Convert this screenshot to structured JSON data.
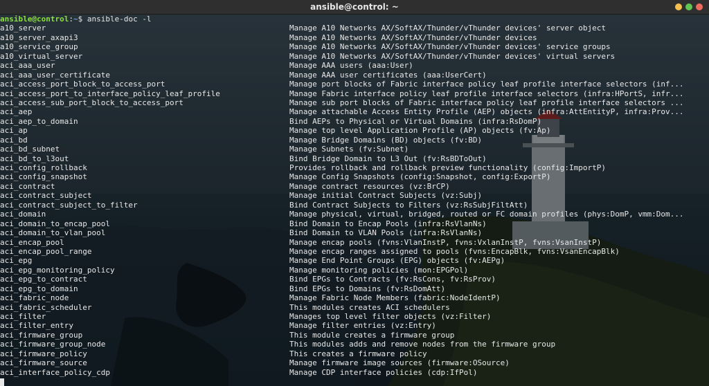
{
  "window": {
    "title": "ansible@control: ~",
    "buttons": [
      {
        "name": "minimize",
        "color": "#f4bf4f"
      },
      {
        "name": "maximize",
        "color": "#61c554"
      },
      {
        "name": "close",
        "color": "#ed6a5e"
      }
    ]
  },
  "terminal": {
    "prompt_user": "ansible@control",
    "prompt_sep": ":",
    "prompt_path": "~",
    "prompt_symbol": "$ ",
    "command": "ansible-doc -l",
    "colors": {
      "user": "#8ae234",
      "path": "#729fcf",
      "text": "#e8e8e8"
    },
    "rows": [
      {
        "module": "a10_server",
        "desc": "Manage A10 Networks AX/SoftAX/Thunder/vThunder devices' server object"
      },
      {
        "module": "a10_server_axapi3",
        "desc": "Manage A10 Networks AX/SoftAX/Thunder/vThunder devices"
      },
      {
        "module": "a10_service_group",
        "desc": "Manage A10 Networks AX/SoftAX/Thunder/vThunder devices' service groups"
      },
      {
        "module": "a10_virtual_server",
        "desc": "Manage A10 Networks AX/SoftAX/Thunder/vThunder devices' virtual servers"
      },
      {
        "module": "aci_aaa_user",
        "desc": "Manage AAA users (aaa:User)"
      },
      {
        "module": "aci_aaa_user_certificate",
        "desc": "Manage AAA user certificates (aaa:UserCert)"
      },
      {
        "module": "aci_access_port_block_to_access_port",
        "desc": "Manage port blocks of Fabric interface policy leaf profile interface selectors (inf..."
      },
      {
        "module": "aci_access_port_to_interface_policy_leaf_profile",
        "desc": "Manage Fabric interface policy leaf profile interface selectors (infra:HPortS, infr..."
      },
      {
        "module": "aci_access_sub_port_block_to_access_port",
        "desc": "Manage sub port blocks of Fabric interface policy leaf profile interface selectors ..."
      },
      {
        "module": "aci_aep",
        "desc": "Manage attachable Access Entity Profile (AEP) objects (infra:AttEntityP, infra:Prov..."
      },
      {
        "module": "aci_aep_to_domain",
        "desc": "Bind AEPs to Physical or Virtual Domains (infra:RsDomP)"
      },
      {
        "module": "aci_ap",
        "desc": "Manage top level Application Profile (AP) objects (fv:Ap)"
      },
      {
        "module": "aci_bd",
        "desc": "Manage Bridge Domains (BD) objects (fv:BD)"
      },
      {
        "module": "aci_bd_subnet",
        "desc": "Manage Subnets (fv:Subnet)"
      },
      {
        "module": "aci_bd_to_l3out",
        "desc": "Bind Bridge Domain to L3 Out (fv:RsBDToOut)"
      },
      {
        "module": "aci_config_rollback",
        "desc": "Provides rollback and rollback preview functionality (config:ImportP)"
      },
      {
        "module": "aci_config_snapshot",
        "desc": "Manage Config Snapshots (config:Snapshot, config:ExportP)"
      },
      {
        "module": "aci_contract",
        "desc": "Manage contract resources (vz:BrCP)"
      },
      {
        "module": "aci_contract_subject",
        "desc": "Manage initial Contract Subjects (vz:Subj)"
      },
      {
        "module": "aci_contract_subject_to_filter",
        "desc": "Bind Contract Subjects to Filters (vz:RsSubjFiltAtt)"
      },
      {
        "module": "aci_domain",
        "desc": "Manage physical, virtual, bridged, routed or FC domain profiles (phys:DomP, vmm:Dom..."
      },
      {
        "module": "aci_domain_to_encap_pool",
        "desc": "Bind Domain to Encap Pools (infra:RsVlanNs)"
      },
      {
        "module": "aci_domain_to_vlan_pool",
        "desc": "Bind Domain to VLAN Pools (infra:RsVlanNs)"
      },
      {
        "module": "aci_encap_pool",
        "desc": "Manage encap pools (fvns:VlanInstP, fvns:VxlanInstP, fvns:VsanInstP)"
      },
      {
        "module": "aci_encap_pool_range",
        "desc": "Manage encap ranges assigned to pools (fvns:EncapBlk, fvns:VsanEncapBlk)"
      },
      {
        "module": "aci_epg",
        "desc": "Manage End Point Groups (EPG) objects (fv:AEPg)"
      },
      {
        "module": "aci_epg_monitoring_policy",
        "desc": "Manage monitoring policies (mon:EPGPol)"
      },
      {
        "module": "aci_epg_to_contract",
        "desc": "Bind EPGs to Contracts (fv:RsCons, fv:RsProv)"
      },
      {
        "module": "aci_epg_to_domain",
        "desc": "Bind EPGs to Domains (fv:RsDomAtt)"
      },
      {
        "module": "aci_fabric_node",
        "desc": "Manage Fabric Node Members (fabric:NodeIdentP)"
      },
      {
        "module": "aci_fabric_scheduler",
        "desc": "This modules creates ACI schedulers"
      },
      {
        "module": "aci_filter",
        "desc": "Manages top level filter objects (vz:Filter)"
      },
      {
        "module": "aci_filter_entry",
        "desc": "Manage filter entries (vz:Entry)"
      },
      {
        "module": "aci_firmware_group",
        "desc": "This module creates a firmware group"
      },
      {
        "module": "aci_firmware_group_node",
        "desc": "This modules adds and remove nodes from the firmware group"
      },
      {
        "module": "aci_firmware_policy",
        "desc": "This creates a firmware policy"
      },
      {
        "module": "aci_firmware_source",
        "desc": "Manage firmware image sources (firmware:OSource)"
      },
      {
        "module": "aci_interface_policy_cdp",
        "desc": "Manage CDP interface policies (cdp:IfPol)"
      }
    ]
  }
}
